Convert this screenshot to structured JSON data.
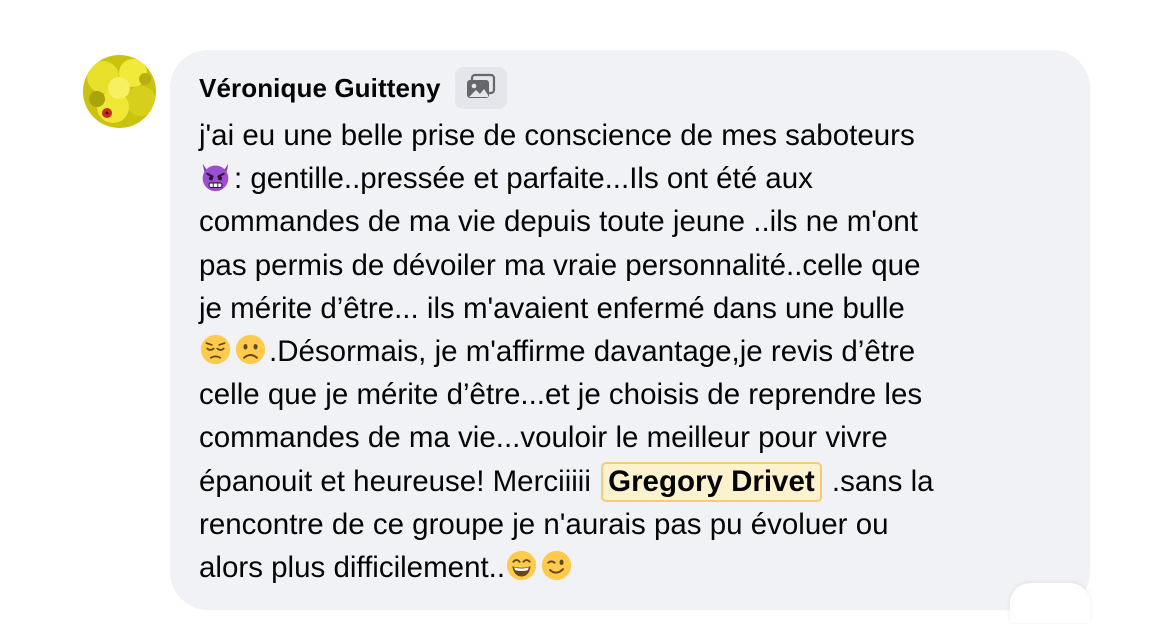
{
  "comment": {
    "author": "Véronique Guitteny",
    "author_badge_icon": "image-badge-icon",
    "avatar_icon": "yellow-flowers-ladybug-avatar",
    "lines": {
      "l1": "j'ai eu une belle prise de conscience de mes saboteurs",
      "l2": ": gentille..pressée et parfaite...Ils ont été aux",
      "l3": "commandes de ma vie depuis toute jeune ..ils ne m'ont",
      "l4": "pas permis de dévoiler ma vraie personnalité..celle que",
      "l5": "je mérite d’être... ils m'avaient enfermé dans une bulle",
      "l6": ".Désormais, je m'affirme davantage,je revis d’être",
      "l7": "celle que je mérite d’être...et je choisis de reprendre les",
      "l8": "commandes de ma vie...vouloir le meilleur pour vivre",
      "l9a": "épanouit et heureuse! Merciiiii",
      "l9b": ".sans la",
      "l10": "rencontre de ce groupe je n'aurais pas pu évoluer ou",
      "l11": "alors plus difficilement.."
    },
    "mention": "Gregory Drivet",
    "emojis": [
      "angry-devil-emoji",
      "pensive-face-emoji",
      "frowning-face-emoji",
      "grinning-face-emoji",
      "winking-face-emoji"
    ],
    "mention_color": "#f3cd75",
    "bubble_color": "#f0f2f5"
  }
}
